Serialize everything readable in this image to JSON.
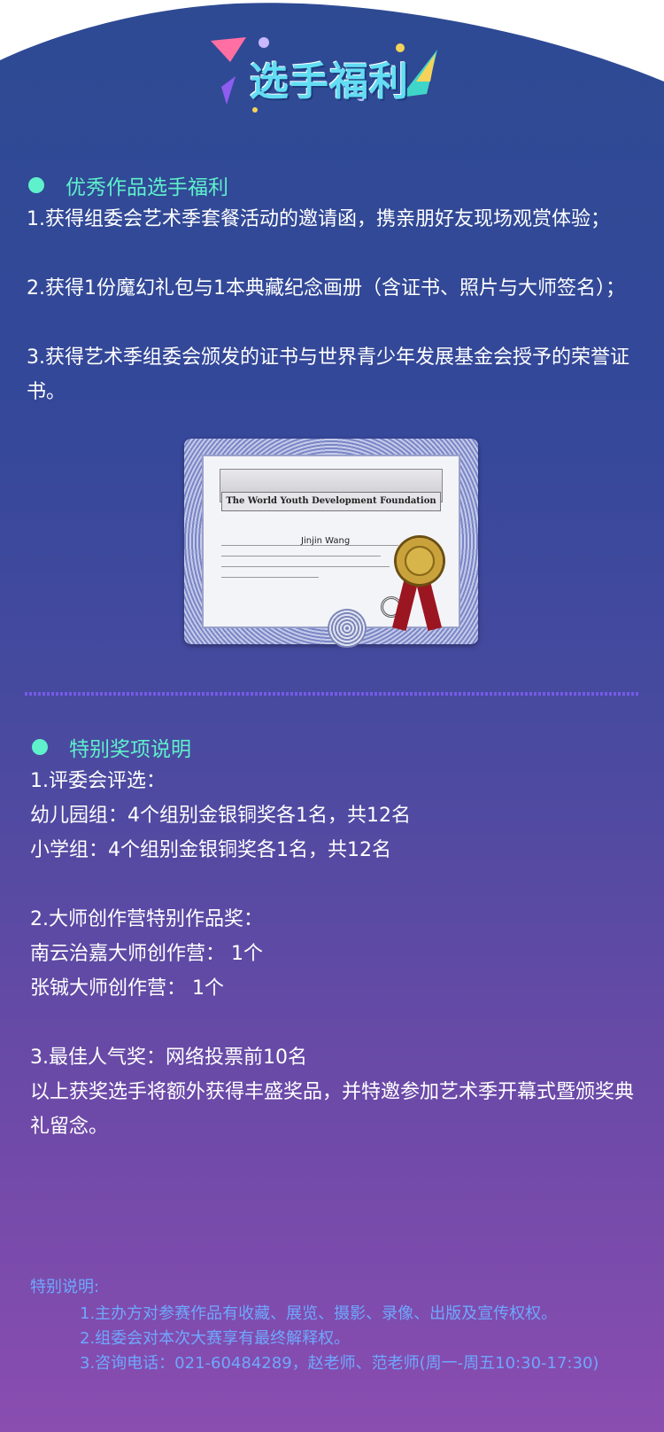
{
  "banner": {
    "title": "选手福利",
    "colors": {
      "title": "#63ddf3",
      "accent_pink": "#ff6fa2",
      "accent_yellow": "#f5d35b",
      "accent_teal": "#3fd6c9"
    }
  },
  "section1": {
    "heading": "优秀作品选手福利",
    "items": [
      "1.获得组委会艺术季套餐活动的邀请函，携亲朋好友现场观赏体验；",
      "2.获得1份魔幻礼包与1本典藏纪念画册（含证书、照片与大师签名）；",
      "3.获得艺术季组委会颁发的证书与世界青少年发展基金会授予的荣誉证书。"
    ]
  },
  "certificate": {
    "org": "The World Youth Development Foundation",
    "name": "Jinjin Wang"
  },
  "section2": {
    "heading": "特别奖项说明",
    "lines": [
      "1.评委会评选：",
      "幼儿园组：4个组别金银铜奖各1名，共12名",
      "小学组：4个组别金银铜奖各1名，共12名",
      "2.大师创作营特别作品奖：",
      "南云治嘉大师创作营： 1个",
      "张铖大师创作营： 1个",
      "3.最佳人气奖：网络投票前10名",
      "以上获奖选手将额外获得丰盛奖品，并特邀参加艺术季开幕式暨颁奖典礼留念。"
    ]
  },
  "notes": {
    "title": "特别说明:",
    "items": [
      "1.主办方对参赛作品有收藏、展览、摄影、录像、出版及宣传权权。",
      "2.组委会对本次大赛享有最终解释权。",
      "3.咨询电话：021-60484289，赵老师、范老师(周一-周五10:30-17:30)"
    ]
  },
  "colors": {
    "heading": "#5ff0cc",
    "note": "#6fa8ff",
    "text": "#ffffff"
  }
}
